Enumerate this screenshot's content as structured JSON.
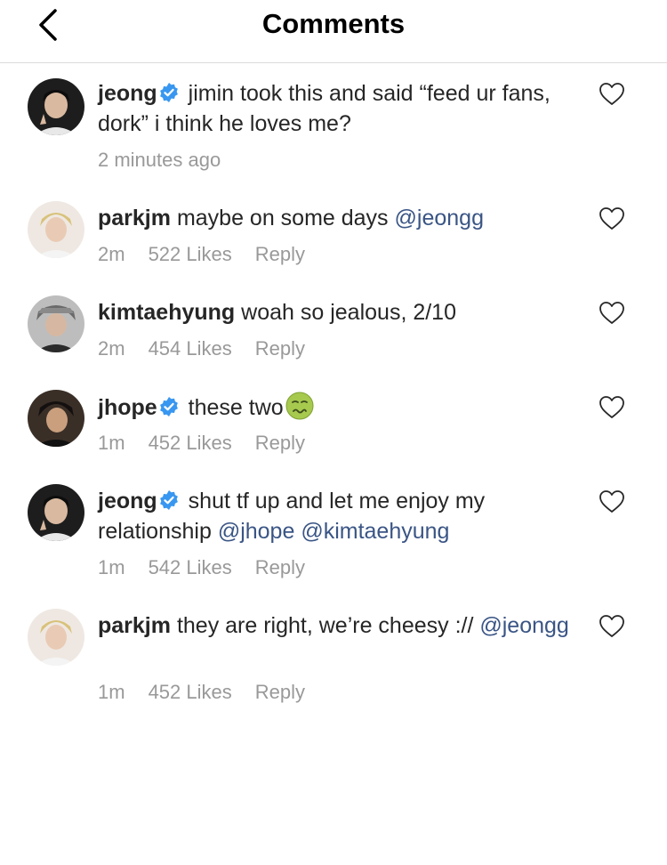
{
  "header": {
    "title": "Comments",
    "back_icon": "chevron-left-icon"
  },
  "colors": {
    "mention": "#3a5585",
    "verified": "#3897f0",
    "meta": "#999999",
    "divider": "#dbdbdb"
  },
  "comments": [
    {
      "username": "jeong",
      "verified": true,
      "text_parts": [
        "jimin took this and said “feed ur fans, dork” i think he loves me?"
      ],
      "meta": {
        "time": "2 minutes ago"
      }
    },
    {
      "username": "parkjm",
      "verified": false,
      "text": "maybe on some days",
      "mentions": [
        "@jeongg"
      ],
      "meta": {
        "time": "2m",
        "likes": "522 Likes",
        "reply": "Reply"
      }
    },
    {
      "username": "kimtaehyung",
      "verified": false,
      "text": "woah so jealous, 2/10",
      "meta": {
        "time": "2m",
        "likes": "454 Likes",
        "reply": "Reply"
      }
    },
    {
      "username": "jhope",
      "verified": true,
      "text": "these two",
      "emoji": "nauseated-face-emoji",
      "meta": {
        "time": "1m",
        "likes": "452 Likes",
        "reply": "Reply"
      }
    },
    {
      "username": "jeong",
      "verified": true,
      "text": "shut tf up and let me enjoy my relationship",
      "mentions": [
        "@jhope",
        "@kimtaehyung"
      ],
      "meta": {
        "time": "1m",
        "likes": "542 Likes",
        "reply": "Reply"
      }
    },
    {
      "username": "parkjm",
      "verified": false,
      "text": "they are right, we’re cheesy ://",
      "mentions": [
        "@jeongg"
      ],
      "meta": {
        "time": "1m",
        "likes": "452 Likes",
        "reply": "Reply"
      }
    }
  ]
}
